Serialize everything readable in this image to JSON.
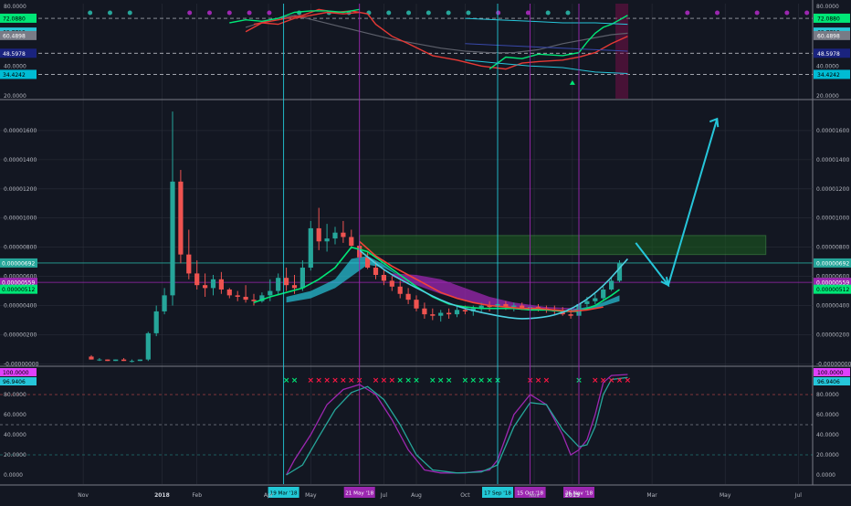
{
  "chart_data": {
    "type": "candlestick",
    "theme": {
      "background": "#131722",
      "grid": "#2a2e39",
      "axis_text": "#b2b5be",
      "divider": "#787b86"
    },
    "x_axis": {
      "ticks": [
        "Nov",
        "2018",
        "Feb",
        "Apr",
        "May",
        "Jul",
        "Aug",
        "Oct",
        "Nov",
        "2019",
        "Mar",
        "May",
        "Jul"
      ],
      "bold_ticks": [
        "2018",
        "2019"
      ]
    },
    "markers": [
      {
        "label": "19 Mar '18",
        "color": "#22c8d6",
        "i": 24
      },
      {
        "label": "21 May '18",
        "color": "#9c27b0",
        "i": 33
      },
      {
        "label": "17 Sep '18",
        "color": "#22c8d6",
        "i": 50
      },
      {
        "label": "15 Oct '18",
        "color": "#9c27b0",
        "i": 54
      },
      {
        "label": "26 Nov '18",
        "color": "#9c27b0",
        "i": 60
      }
    ],
    "top_panel": {
      "ylim": [
        20,
        80
      ],
      "ticks": [
        "80.0000",
        "60.0000",
        "40.0000",
        "20.0000"
      ],
      "levels": [
        {
          "label": "72.0880",
          "value": 72.088,
          "color": "#00e676",
          "text_color": "#000000"
        },
        {
          "label": "62.7713",
          "value": 62.7713,
          "color": "#26c6da",
          "text_color": "#000000"
        },
        {
          "label": "60.4898",
          "value": 60.4898,
          "color": "#787b86",
          "text_color": "#ffffff"
        },
        {
          "label": "48.5978",
          "value": 48.5978,
          "color": "#1a237e",
          "text_color": "#ffffff"
        },
        {
          "label": "34.4242",
          "value": 34.4242,
          "color": "#00bcd4",
          "text_color": "#000000"
        }
      ],
      "dashed_levels": [
        72,
        48.6,
        34.4
      ],
      "dots": {
        "indices": [
          3,
          4,
          5,
          6,
          7,
          8,
          9,
          10,
          11,
          12,
          13,
          14,
          15,
          16,
          17,
          18,
          19,
          20,
          21,
          22,
          23,
          24,
          25,
          26,
          27,
          28,
          29,
          30,
          31,
          32,
          33,
          34,
          35,
          36,
          37,
          38,
          39,
          40
        ],
        "colors": [
          "#26a69a",
          "#26a69a",
          "#26a69a",
          "#9c27b0",
          "#9c27b0",
          "#9c27b0",
          "#9c27b0",
          "#9c27b0",
          "#26a69a",
          "#26a69a",
          "#26a69a",
          "#26a69a",
          "#26a69a",
          "#26a69a",
          "#26a69a",
          "#26a69a",
          "#26a69a",
          "#9c27b0",
          "#9c27b0",
          "#26a69a",
          "#26a69a",
          "#9c27b0",
          "#9c27b0",
          "#9c27b0",
          "#9c27b0",
          "#9c27b0"
        ]
      }
    },
    "main_panel": {
      "ylim": [
        -1e-07,
        1.8e-05
      ],
      "ticks": [
        "0.00001600",
        "0.00001400",
        "0.00001200",
        "0.00001000",
        "0.00000800",
        "0.00000600",
        "0.00000400",
        "0.00000200",
        "-0.00000000"
      ],
      "tick_values": [
        1.6e-05,
        1.4e-05,
        1.2e-05,
        1e-05,
        8e-06,
        6e-06,
        4e-06,
        2e-06,
        0
      ],
      "price_labels": [
        {
          "label": "0.00000692",
          "value": 6.92e-06,
          "color": "#26a69a",
          "text_color": "#ffffff"
        },
        {
          "label": "0.00000559",
          "value": 5.59e-06,
          "color": "#9c27b0",
          "text_color": "#ffffff"
        },
        {
          "label": "0.00000512",
          "value": 5.12e-06,
          "color": "#00e676",
          "text_color": "#000000"
        }
      ],
      "candles": [
        [
          5e-07,
          6e-07,
          3e-07,
          3e-07
        ],
        [
          3e-07,
          4e-07,
          2e-07,
          3e-07
        ],
        [
          3e-07,
          3e-07,
          2e-07,
          2e-07
        ],
        [
          2e-07,
          3e-07,
          2e-07,
          3e-07
        ],
        [
          3e-07,
          4e-07,
          2e-07,
          2e-07
        ],
        [
          2e-07,
          3e-07,
          1e-07,
          2e-07
        ],
        [
          2e-07,
          3e-07,
          2e-07,
          3e-07
        ],
        [
          3e-07,
          2.2e-06,
          2e-07,
          2.1e-06
        ],
        [
          2.1e-06,
          4e-06,
          1.9e-06,
          3.6e-06
        ],
        [
          3.6e-06,
          5.2e-06,
          3.4e-06,
          4.7e-06
        ],
        [
          4.7e-06,
          1.73e-05,
          4e-06,
          1.25e-05
        ],
        [
          1.25e-05,
          1.33e-05,
          6.9e-06,
          7.5e-06
        ],
        [
          7.5e-06,
          9.2e-06,
          5.8e-06,
          6.2e-06
        ],
        [
          6.2e-06,
          7.1e-06,
          5.1e-06,
          5.4e-06
        ],
        [
          5.4e-06,
          6.2e-06,
          4.6e-06,
          5.2e-06
        ],
        [
          5.2e-06,
          6.1e-06,
          4.7e-06,
          5.8e-06
        ],
        [
          5.8e-06,
          6.3e-06,
          4.8e-06,
          5.1e-06
        ],
        [
          5.1e-06,
          5.2e-06,
          4.5e-06,
          4.7e-06
        ],
        [
          4.7e-06,
          5e-06,
          4.3e-06,
          4.6e-06
        ],
        [
          4.6e-06,
          5.4e-06,
          4.2e-06,
          4.4e-06
        ],
        [
          4.4e-06,
          4.8e-06,
          4e-06,
          4.3e-06
        ],
        [
          4.3e-06,
          4.9e-06,
          4.2e-06,
          4.7e-06
        ],
        [
          4.7e-06,
          5.8e-06,
          4.3e-06,
          5e-06
        ],
        [
          5e-06,
          6.2e-06,
          4.7e-06,
          5.9e-06
        ],
        [
          5.9e-06,
          6.6e-06,
          5e-06,
          5.4e-06
        ],
        [
          5.4e-06,
          6.1e-06,
          4.8e-06,
          5.2e-06
        ],
        [
          5.2e-06,
          7.1e-06,
          5e-06,
          6.6e-06
        ],
        [
          6.6e-06,
          9.8e-06,
          6.4e-06,
          9.3e-06
        ],
        [
          9.3e-06,
          1.07e-05,
          7.8e-06,
          8.4e-06
        ],
        [
          8.4e-06,
          9.6e-06,
          7.7e-06,
          8.6e-06
        ],
        [
          8.6e-06,
          9.4e-06,
          8.2e-06,
          9e-06
        ],
        [
          9e-06,
          9.8e-06,
          8.3e-06,
          8.7e-06
        ],
        [
          8.7e-06,
          9.2e-06,
          7.9e-06,
          8.1e-06
        ],
        [
          8.1e-06,
          8.3e-06,
          7.1e-06,
          7.3e-06
        ],
        [
          7.3e-06,
          7.7e-06,
          6.5e-06,
          6.6e-06
        ],
        [
          6.6e-06,
          7e-06,
          5.8e-06,
          6.1e-06
        ],
        [
          6.1e-06,
          6.5e-06,
          5.4e-06,
          5.7e-06
        ],
        [
          5.7e-06,
          6e-06,
          5e-06,
          5.3e-06
        ],
        [
          5.3e-06,
          5.7e-06,
          4.5e-06,
          4.8e-06
        ],
        [
          4.8e-06,
          5.2e-06,
          4.1e-06,
          4.4e-06
        ],
        [
          4.4e-06,
          4.7e-06,
          3.6e-06,
          3.8e-06
        ],
        [
          3.8e-06,
          4.2e-06,
          3.1e-06,
          3.4e-06
        ],
        [
          3.4e-06,
          3.8e-06,
          3e-06,
          3.3e-06
        ],
        [
          3.3e-06,
          3.7e-06,
          2.9e-06,
          3.5e-06
        ],
        [
          3.5e-06,
          3.8e-06,
          3.1e-06,
          3.4e-06
        ],
        [
          3.4e-06,
          3.9e-06,
          3.2e-06,
          3.7e-06
        ],
        [
          3.7e-06,
          4e-06,
          3.4e-06,
          3.6e-06
        ],
        [
          3.6e-06,
          4e-06,
          3.3e-06,
          3.8e-06
        ],
        [
          3.8e-06,
          4.2e-06,
          3.5e-06,
          4e-06
        ],
        [
          4e-06,
          4.3e-06,
          3.6e-06,
          3.9e-06
        ],
        [
          3.9e-06,
          4.2e-06,
          3.5e-06,
          4.1e-06
        ],
        [
          4.1e-06,
          4.3e-06,
          3.7e-06,
          3.9e-06
        ],
        [
          3.9e-06,
          4.2e-06,
          3.6e-06,
          4e-06
        ],
        [
          4e-06,
          4.2e-06,
          3.7e-06,
          3.8e-06
        ],
        [
          3.8e-06,
          4.1e-06,
          3.5e-06,
          3.9e-06
        ],
        [
          3.9e-06,
          4.1e-06,
          3.6e-06,
          3.8e-06
        ],
        [
          3.8e-06,
          4e-06,
          3.5e-06,
          3.7e-06
        ],
        [
          3.7e-06,
          4e-06,
          3.4e-06,
          3.6e-06
        ],
        [
          3.6e-06,
          3.9e-06,
          3.3e-06,
          3.4e-06
        ],
        [
          3.4e-06,
          3.8e-06,
          3.1e-06,
          3.3e-06
        ],
        [
          3.3e-06,
          4.2e-06,
          3.1e-06,
          4.1e-06
        ],
        [
          4.1e-06,
          4.6e-06,
          3.9e-06,
          4.3e-06
        ],
        [
          4.3e-06,
          4.8e-06,
          4.1e-06,
          4.5e-06
        ],
        [
          4.5e-06,
          5.3e-06,
          4.4e-06,
          5.1e-06
        ],
        [
          5.1e-06,
          5.9e-06,
          5e-06,
          5.7e-06
        ],
        [
          5.7e-06,
          7.1e-06,
          5.6e-06,
          6.9e-06
        ]
      ],
      "ma_green": [
        [
          20,
          4.2e-06
        ],
        [
          22,
          4.6e-06
        ],
        [
          24,
          4.9e-06
        ],
        [
          26,
          5.2e-06
        ],
        [
          28,
          5.8e-06
        ],
        [
          30,
          6.6e-06
        ],
        [
          32,
          8e-06
        ],
        [
          34,
          7.7e-06
        ],
        [
          36,
          6.9e-06
        ],
        [
          38,
          6.1e-06
        ],
        [
          40,
          5.3e-06
        ],
        [
          42,
          4.6e-06
        ],
        [
          44,
          4.1e-06
        ],
        [
          46,
          3.9e-06
        ],
        [
          48,
          3.8e-06
        ],
        [
          50,
          3.8e-06
        ],
        [
          52,
          3.8e-06
        ],
        [
          54,
          3.7e-06
        ],
        [
          56,
          3.7e-06
        ],
        [
          58,
          3.6e-06
        ],
        [
          60,
          3.6e-06
        ],
        [
          62,
          4e-06
        ],
        [
          64,
          4.7e-06
        ],
        [
          65,
          5.1e-06
        ]
      ],
      "ma_red": [
        [
          33,
          8.4e-06
        ],
        [
          35,
          7.4e-06
        ],
        [
          37,
          6.7e-06
        ],
        [
          39,
          6.1e-06
        ],
        [
          41,
          5.5e-06
        ],
        [
          43,
          4.9e-06
        ],
        [
          45,
          4.5e-06
        ],
        [
          47,
          4.2e-06
        ],
        [
          49,
          4e-06
        ],
        [
          51,
          3.9e-06
        ],
        [
          53,
          3.8e-06
        ],
        [
          55,
          3.8e-06
        ],
        [
          57,
          3.7e-06
        ],
        [
          59,
          3.6e-06
        ],
        [
          61,
          3.7e-06
        ],
        [
          63,
          3.9e-06
        ]
      ],
      "zone": {
        "from_i": 33,
        "to_i": 66,
        "y1": 8.8e-06,
        "y2": 7.5e-06,
        "color": "#1b5e20",
        "edge": "#43a047"
      },
      "arc": [
        [
          33,
          7.8e-06
        ],
        [
          36,
          6.4e-06
        ],
        [
          40,
          5.2e-06
        ],
        [
          44,
          4.1e-06
        ],
        [
          48,
          3.5e-06
        ],
        [
          52,
          3.1e-06
        ],
        [
          54,
          3.1e-06
        ],
        [
          57,
          3.3e-06
        ],
        [
          60,
          4e-06
        ],
        [
          63,
          5.3e-06
        ],
        [
          66,
          7.2e-06
        ]
      ],
      "arrow_path": [
        [
          67,
          8.3e-06
        ],
        [
          71,
          5.4e-06
        ],
        [
          77,
          1.68e-05
        ]
      ]
    },
    "bottom_panel": {
      "ylim": [
        0,
        100
      ],
      "ticks": [
        "80.0000",
        "60.0000",
        "40.0000",
        "20.0000",
        "0.0000"
      ],
      "levels": [
        {
          "label": "100.0000",
          "value": 100,
          "color": "#e040fb",
          "text_color": "#000000"
        },
        {
          "label": "96.9406",
          "value": 96.9406,
          "color": "#26c6da",
          "text_color": "#000000"
        }
      ],
      "dashed_levels": [
        80,
        50,
        20
      ],
      "stoch_k": [
        [
          24,
          0
        ],
        [
          25,
          15
        ],
        [
          27,
          40
        ],
        [
          29,
          70
        ],
        [
          31,
          85
        ],
        [
          33,
          90
        ],
        [
          35,
          80
        ],
        [
          37,
          55
        ],
        [
          39,
          25
        ],
        [
          41,
          5
        ],
        [
          43,
          2
        ],
        [
          46,
          2
        ],
        [
          49,
          5
        ],
        [
          50,
          15
        ],
        [
          52,
          60
        ],
        [
          54,
          80
        ],
        [
          56,
          70
        ],
        [
          58,
          40
        ],
        [
          59,
          20
        ],
        [
          60,
          25
        ],
        [
          61,
          35
        ],
        [
          62,
          60
        ],
        [
          63,
          92
        ],
        [
          64,
          99
        ],
        [
          66,
          100
        ]
      ],
      "stoch_d": [
        [
          24,
          0
        ],
        [
          26,
          10
        ],
        [
          28,
          38
        ],
        [
          30,
          65
        ],
        [
          32,
          82
        ],
        [
          34,
          88
        ],
        [
          36,
          75
        ],
        [
          38,
          50
        ],
        [
          40,
          20
        ],
        [
          42,
          5
        ],
        [
          45,
          2
        ],
        [
          48,
          3
        ],
        [
          50,
          10
        ],
        [
          52,
          48
        ],
        [
          54,
          72
        ],
        [
          56,
          70
        ],
        [
          58,
          45
        ],
        [
          60,
          28
        ],
        [
          61,
          30
        ],
        [
          62,
          48
        ],
        [
          63,
          80
        ],
        [
          64,
          95
        ],
        [
          66,
          97
        ]
      ],
      "signals": {
        "green_indices": [
          24,
          25,
          38,
          39,
          40,
          42,
          43,
          44,
          46,
          47,
          48,
          49,
          50,
          60
        ],
        "red_indices": [
          27,
          28,
          29,
          30,
          31,
          32,
          33,
          35,
          36,
          37,
          54,
          55,
          56,
          62,
          63,
          64,
          65,
          66
        ]
      }
    }
  }
}
